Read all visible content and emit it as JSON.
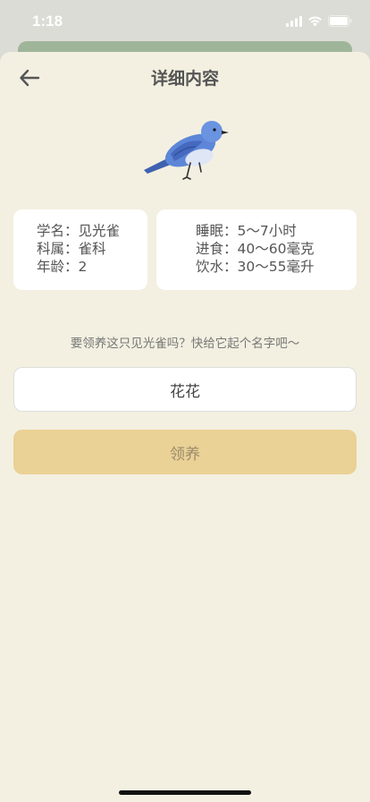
{
  "status_bar": {
    "time": "1:18"
  },
  "nav": {
    "title": "详细内容"
  },
  "info_left": {
    "scientific_name": "学名：见光雀",
    "family": "科属：雀科",
    "age": "年龄：2"
  },
  "info_right": {
    "sleep": "睡眠：5～7小时",
    "food": "进食：40～60毫克",
    "water": "饮水：30～55毫升"
  },
  "adopt": {
    "prompt": "要领养这只见光雀吗？快给它起个名字吧～",
    "name_value": "花花",
    "button_label": "领养"
  },
  "colors": {
    "sheet_bg": "#f3f0e1",
    "button_bg": "#ead196",
    "bird_blue": "#5d86d8"
  }
}
